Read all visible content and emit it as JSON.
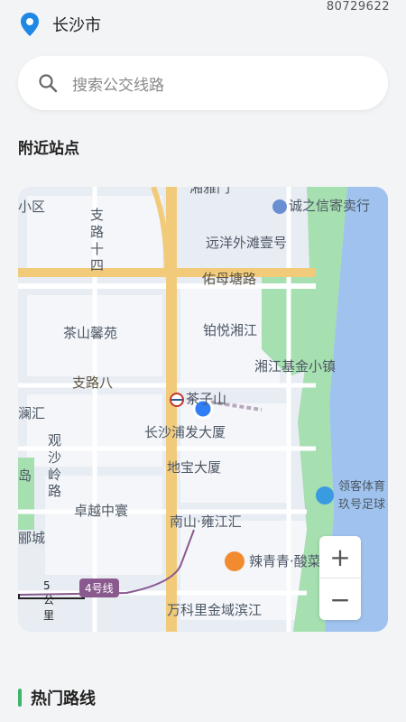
{
  "status": {
    "device_id": "80729622"
  },
  "location": {
    "city": "长沙市",
    "icon": "location-pin-icon",
    "icon_color": "#1e88e5"
  },
  "search": {
    "placeholder": "搜索公交线路",
    "icon": "search-icon"
  },
  "nearby": {
    "title": "附近站点"
  },
  "map": {
    "labels": {
      "district_partial": "小区",
      "top_road_partial": "湘雅门",
      "credit_shop": "诚之信寄卖行",
      "road_zhilu_14": "支路十四",
      "yuanyang": "远洋外滩壹号",
      "youmu_road": "佑母塘路",
      "chashan_xinyuan": "茶山馨苑",
      "boyue": "铂悦湘江",
      "xiangjiang_jinxiao": "湘江基金小镇",
      "road_zhilu_8": "支路八",
      "chaziushan_station": "茶子山",
      "lanjiang_partial": "澜汇",
      "pufa": "长沙浦发大厦",
      "guanshaling_road": "观沙岭路",
      "dibao": "地宝大厦",
      "dao_partial": "岛",
      "lingke": "领客体育",
      "jiuhao": "玖号足球",
      "zhuoyue": "卓越中寰",
      "nanshan": "南山·雍江汇",
      "yucheng_partial": "郦城",
      "laqingqing": "辣青青·酸菜",
      "wankeli": "万科里金域滨江"
    },
    "scale": "5公里",
    "metro_line": "4号线",
    "zoom_in": "+",
    "zoom_out": "−",
    "colors": {
      "land": "#e8ecf3",
      "block": "#f4f6fa",
      "green": "#a6dfb0",
      "water": "#9fc3ee",
      "main_road": "#f2cb7a",
      "minor_road": "#ffffff",
      "metro": "#8a5a8f",
      "current_location": "#2f7ef5"
    }
  },
  "hot_routes": {
    "title": "热门路线",
    "accent_color": "#3fb56b"
  }
}
